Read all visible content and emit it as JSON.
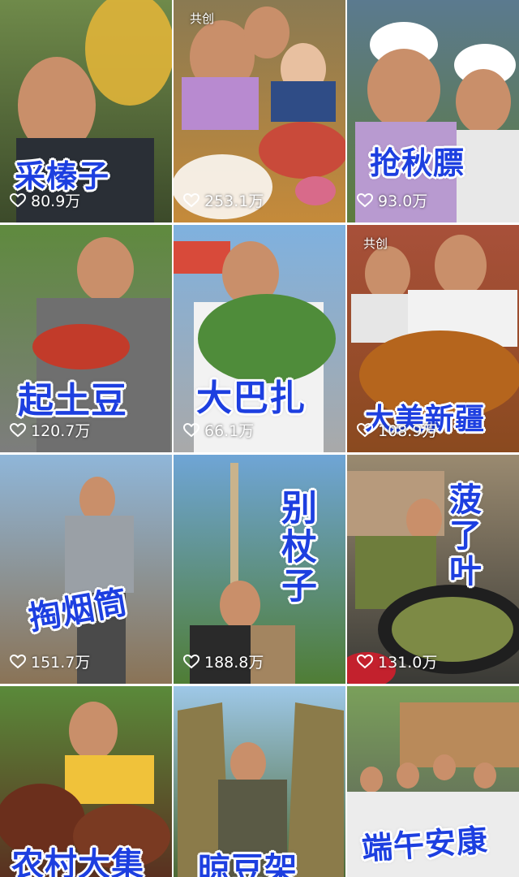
{
  "grid": {
    "tiles": [
      {
        "title": "采榛子",
        "likes": "80.9万",
        "badge": "",
        "vertical": false,
        "colors": {
          "top": "#6f8a4a",
          "bottom": "#3c4a2a",
          "accent": "#e0b438"
        }
      },
      {
        "title": "",
        "likes": "253.1万",
        "badge": "共创",
        "vertical": false,
        "colors": {
          "top": "#8a7a52",
          "bottom": "#c58a3a",
          "accent": "#c94a3a"
        }
      },
      {
        "title": "抢秋膘",
        "likes": "93.0万",
        "badge": "",
        "vertical": false,
        "colors": {
          "top": "#5b7a8f",
          "bottom": "#5d7b3c",
          "accent": "#b89ad0"
        }
      },
      {
        "title": "起土豆",
        "likes": "120.7万",
        "badge": "",
        "vertical": false,
        "colors": {
          "top": "#5f8a3e",
          "bottom": "#7d7d7d",
          "accent": "#c23b2a"
        }
      },
      {
        "title": "大巴扎",
        "likes": "66.1万",
        "badge": "",
        "vertical": false,
        "colors": {
          "top": "#7fb1df",
          "bottom": "#a9a9a9",
          "accent": "#4f8c3a"
        }
      },
      {
        "title": "大美新疆",
        "likes": "108.9万",
        "badge": "共创",
        "vertical": false,
        "colors": {
          "top": "#a8503a",
          "bottom": "#8a4a1f",
          "accent": "#b5651d"
        }
      },
      {
        "title": "掏烟筒",
        "likes": "151.7万",
        "badge": "",
        "vertical": false,
        "colors": {
          "top": "#8fb6d9",
          "bottom": "#8a7356",
          "accent": "#9aa0a6"
        }
      },
      {
        "title": "别杖子",
        "likes": "188.8万",
        "badge": "",
        "vertical": true,
        "colors": {
          "top": "#6fa5d6",
          "bottom": "#4f7d35",
          "accent": "#c9b38c"
        }
      },
      {
        "title": "菠了叶",
        "likes": "131.0万",
        "badge": "",
        "vertical": true,
        "colors": {
          "top": "#9a8a70",
          "bottom": "#3a3a36",
          "accent": "#6e7d3c"
        }
      },
      {
        "title": "农村大集",
        "likes": "",
        "badge": "",
        "vertical": false,
        "colors": {
          "top": "#5a8a3a",
          "bottom": "#5a3020",
          "accent": "#f0c23a"
        }
      },
      {
        "title": "晾豆架",
        "likes": "",
        "badge": "",
        "vertical": false,
        "colors": {
          "top": "#9ec8e8",
          "bottom": "#4e6a35",
          "accent": "#8b7b4a"
        }
      },
      {
        "title": "端午安康",
        "likes": "",
        "badge": "",
        "vertical": false,
        "colors": {
          "top": "#7aa05a",
          "bottom": "#5a5a5a",
          "accent": "#b98a5a"
        }
      }
    ]
  }
}
